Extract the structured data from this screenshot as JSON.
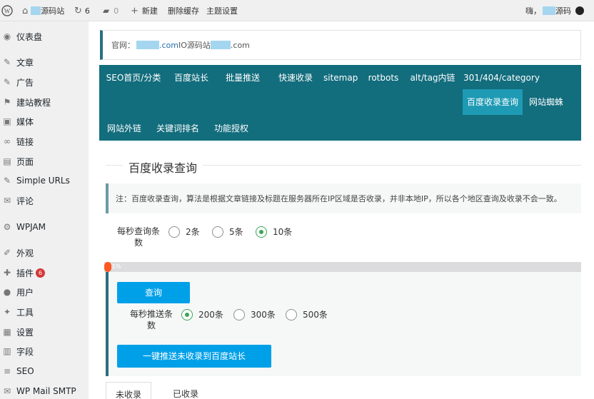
{
  "admin_bar": {
    "site_name": "源码站",
    "updates_count": "6",
    "comments_count": "0",
    "new_label": "新建",
    "clear_cache_label": "删除缓存",
    "theme_settings_label": "主题设置",
    "greeting": "嗨，",
    "user_name": "源码"
  },
  "sidebar": {
    "items": [
      {
        "icon": "dashboard-icon",
        "glyph": "◉",
        "label": "仪表盘"
      },
      {
        "icon": "pin-icon",
        "glyph": "✎",
        "label": "文章"
      },
      {
        "icon": "pin-icon",
        "glyph": "✎",
        "label": "广告"
      },
      {
        "icon": "flag-icon",
        "glyph": "⚑",
        "label": "建站教程"
      },
      {
        "icon": "media-icon",
        "glyph": "▣",
        "label": "媒体"
      },
      {
        "icon": "link-icon",
        "glyph": "∞",
        "label": "链接"
      },
      {
        "icon": "page-icon",
        "glyph": "▤",
        "label": "页面"
      },
      {
        "icon": "pin-icon",
        "glyph": "✎",
        "label": "Simple URLs"
      },
      {
        "icon": "comment-icon",
        "glyph": "✉",
        "label": "评论"
      },
      {
        "icon": "gear-icon",
        "glyph": "⚙",
        "label": "WPJAM"
      },
      {
        "icon": "appearance-icon",
        "glyph": "✐",
        "label": "外观"
      },
      {
        "icon": "plugin-icon",
        "glyph": "✚",
        "label": "插件",
        "badge": "6"
      },
      {
        "icon": "user-icon",
        "glyph": "●",
        "label": "用户"
      },
      {
        "icon": "wrench-icon",
        "glyph": "✦",
        "label": "工具"
      },
      {
        "icon": "settings-icon",
        "glyph": "▦",
        "label": "设置"
      },
      {
        "icon": "fields-icon",
        "glyph": "▥",
        "label": "字段"
      },
      {
        "icon": "seo-icon",
        "glyph": "≡",
        "label": "SEO"
      },
      {
        "icon": "mail-icon",
        "glyph": "✉",
        "label": "WP Mail SMTP"
      }
    ]
  },
  "official": {
    "prefix": "官网：",
    "domain1_suffix": ".com",
    "middle": " IO源码站",
    "domain2_suffix": ".com"
  },
  "nav_tabs": [
    {
      "label": "SEO首页/分类"
    },
    {
      "label": "百度站长"
    },
    {
      "label": "批量推送"
    },
    {
      "label": "快速收录"
    },
    {
      "label": "sitemap"
    },
    {
      "label": "rotbots"
    },
    {
      "label": "alt/tag内链"
    },
    {
      "label": "301/404/category"
    },
    {
      "label": "百度收录查询",
      "active": true
    },
    {
      "label": "网站蜘蛛"
    },
    {
      "label": "网站外链"
    },
    {
      "label": "关键词排名"
    },
    {
      "label": "功能授权"
    }
  ],
  "section": {
    "title": "百度收录查询",
    "notice": "注：百度收录查询，算法是根据文章链接及标题在服务器所在IP区域是否收录，并非本地IP，所以各个地区查询及收录不会一致。"
  },
  "query_rate": {
    "label": "每秒查询条数",
    "options": [
      "2条",
      "5条",
      "10条"
    ],
    "selected": "10条"
  },
  "progress": {
    "percent": 0.01,
    "text": "1%"
  },
  "panel": {
    "query_button": "查询",
    "push_rate_label": "每秒推送条数",
    "push_options": [
      "200条",
      "300条",
      "500条"
    ],
    "push_selected": "200条",
    "push_button": "一键推送未收录到百度站长"
  },
  "sub_tabs": [
    {
      "label": "未收录",
      "active": true
    },
    {
      "label": "已收录"
    }
  ]
}
